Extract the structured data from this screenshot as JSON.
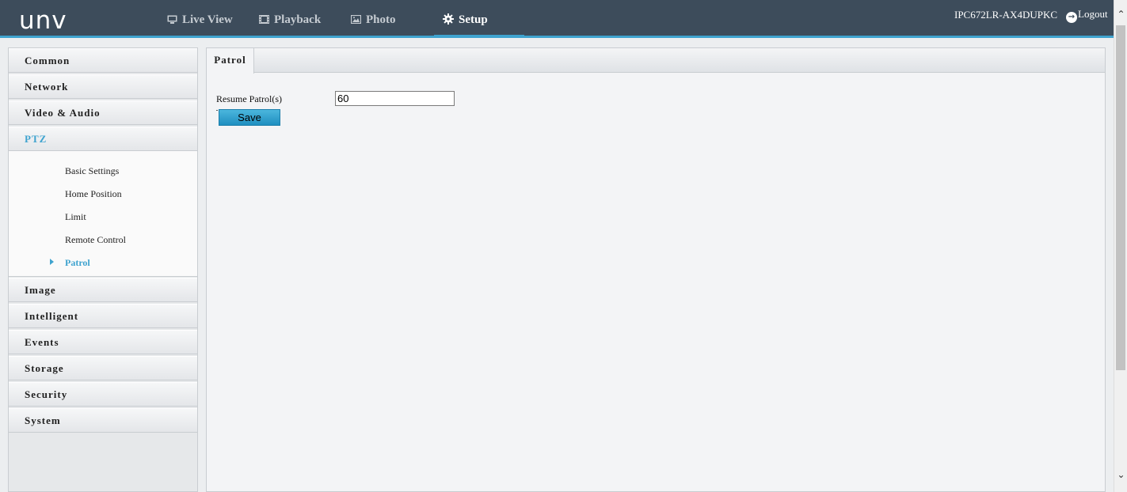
{
  "app": {
    "logo": "unv"
  },
  "nav": {
    "items": [
      {
        "label": "Live View",
        "icon": "monitor-icon"
      },
      {
        "label": "Playback",
        "icon": "film-icon"
      },
      {
        "label": "Photo",
        "icon": "picture-icon"
      },
      {
        "label": "Setup",
        "icon": "gear-icon",
        "active": true
      }
    ]
  },
  "header": {
    "device_name": "IPC672LR-AX4DUPKC",
    "logout_label": "Logout"
  },
  "sidebar": {
    "menus": [
      {
        "label": "Common"
      },
      {
        "label": "Network"
      },
      {
        "label": "Video & Audio"
      },
      {
        "label": "PTZ",
        "active": true
      },
      {
        "label": "Image"
      },
      {
        "label": "Intelligent"
      },
      {
        "label": "Events"
      },
      {
        "label": "Storage"
      },
      {
        "label": "Security"
      },
      {
        "label": "System"
      }
    ],
    "ptz_items": [
      {
        "label": "Basic Settings"
      },
      {
        "label": "Home Position"
      },
      {
        "label": "Limit"
      },
      {
        "label": "Remote Control"
      },
      {
        "label": "Patrol",
        "active": true
      }
    ]
  },
  "main": {
    "tab": "Patrol",
    "resume_label": "Resume Patrol(s)",
    "resume_value": "60",
    "save_label": "Save"
  },
  "colors": {
    "topbar": "#3d4c5b",
    "accent": "#3fa3cf"
  }
}
